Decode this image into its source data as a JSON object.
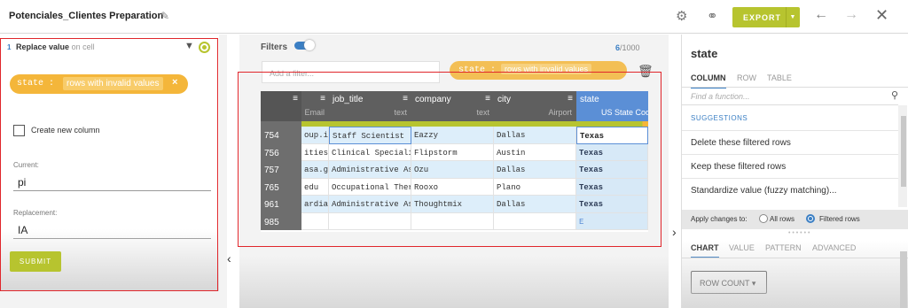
{
  "header": {
    "title": "Potenciales_Clientes Preparation",
    "export_label": "EXPORT",
    "icons": [
      "pencil-icon",
      "gear-icon",
      "link-icon",
      "chevron-down-icon",
      "arrow-left-icon",
      "arrow-right-icon",
      "close-icon"
    ]
  },
  "step": {
    "number": "1",
    "title": "Replace value",
    "subtitle": "on cell",
    "filter_column": "state :",
    "filter_condition": "rows with invalid values",
    "filter_remove": "×",
    "create_column_label": "Create new column",
    "current_label": "Current:",
    "current_value": "pi",
    "replacement_label": "Replacement:",
    "replacement_value": "IA",
    "submit_label": "SUBMIT"
  },
  "filters": {
    "label": "Filters",
    "count_visible": "6",
    "count_total": "/1000",
    "add_placeholder": "Add a filter...",
    "active_filter_column": "state :",
    "active_filter_condition": "rows with invalid values"
  },
  "grid": {
    "columns": [
      {
        "name": "",
        "meaning": "Email"
      },
      {
        "name": "job_title",
        "meaning": "text"
      },
      {
        "name": "company",
        "meaning": "text"
      },
      {
        "name": "city",
        "meaning": "Airport"
      },
      {
        "name": "state",
        "meaning": "US State Code"
      }
    ],
    "rows": [
      {
        "num": "754",
        "cells": [
          "oup.io",
          "Staff Scientist",
          "Eazzy",
          "Dallas",
          "Texas"
        ]
      },
      {
        "num": "756",
        "cells": [
          "ities.jp",
          "Clinical Specialist",
          "Flipstorm",
          "Austin",
          "Texas"
        ]
      },
      {
        "num": "757",
        "cells": [
          "asa.gov",
          "Administrative Assistant",
          "Ozu",
          "Dallas",
          "Texas"
        ]
      },
      {
        "num": "765",
        "cells": [
          "edu",
          "Occupational Therapist",
          "Rooxo",
          "Plano",
          "Texas"
        ]
      },
      {
        "num": "961",
        "cells": [
          "ardian.c",
          "Administrative Assistant",
          "Thoughtmix",
          "Dallas",
          "Texas"
        ]
      },
      {
        "num": "985",
        "cells": [
          "",
          "",
          "",
          "",
          "E"
        ]
      }
    ]
  },
  "right_panel": {
    "title": "state",
    "tabs": [
      "COLUMN",
      "ROW",
      "TABLE"
    ],
    "find_placeholder": "Find a function...",
    "suggestions_label": "SUGGESTIONS",
    "functions": [
      "Delete these filtered rows",
      "Keep these filtered rows",
      "Standardize value (fuzzy matching)..."
    ],
    "apply_label": "Apply changes to:",
    "apply_all": "All rows",
    "apply_filtered": "Filtered rows",
    "chart_tabs": [
      "CHART",
      "VALUE",
      "PATTERN",
      "ADVANCED"
    ],
    "rowcount_label": "ROW COUNT",
    "rowcount_caret": "▾"
  },
  "colors": {
    "accent": "#b7c42f",
    "filter": "#f4b63a",
    "link": "#3b7fc4",
    "annotation": "#e0262b"
  }
}
